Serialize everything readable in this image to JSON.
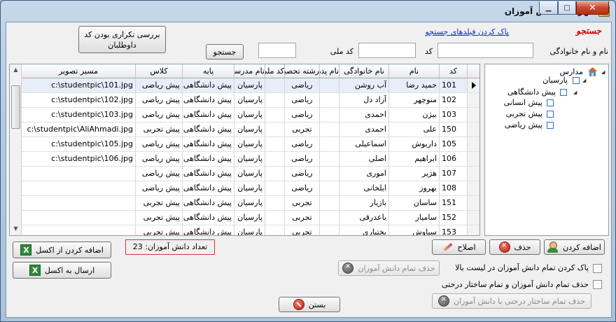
{
  "window": {
    "title": "فهرست دانش آموزان",
    "close_glyph": "✕",
    "minimize_glyph": "▁",
    "maximize_glyph": "□"
  },
  "search": {
    "title": "جستجو",
    "clear_link": "پاک کردن فیلدهای جستجو",
    "name_label": "نام و نام خانوادگی",
    "code_label": "کد",
    "national_code_label": "کد ملی",
    "search_button": "جستجو",
    "name_value": "",
    "code_value": "",
    "national_code_value": ""
  },
  "duplicate_button": {
    "line1": "بررسی تکراری بودن کد",
    "line2": "داوطلبان"
  },
  "grid": {
    "columns": [
      "کد",
      "نام",
      "نام خانوادگی",
      "نام پدر",
      "رشته تحصیلی",
      "کد ملی",
      "نام مدرسه",
      "پایه",
      "کلاس",
      "مسیر تصویر"
    ],
    "rows": [
      [
        "101",
        "حمید رضا",
        "آب روشن",
        "",
        "ریاضی",
        "",
        "پارسیان",
        "",
        "پیش دانشگاهی",
        "پیش ریاضی",
        "c:\\studentpic\\101.jpg"
      ],
      [
        "102",
        "منوچهر",
        "آزاد دل",
        "",
        "ریاضی",
        "",
        "پارسیان",
        "",
        "پیش دانشگاهی",
        "پیش ریاضی",
        "c:\\studentpic\\102.jpg"
      ],
      [
        "103",
        "بیژن",
        "احمدی",
        "",
        "ریاضی",
        "",
        "پارسیان",
        "",
        "پیش دانشگاهی",
        "پیش ریاضی",
        "c:\\studentpic\\103.jpg"
      ],
      [
        "150",
        "علی",
        "احمدی",
        "",
        "تجربی",
        "",
        "پارسیان",
        "",
        "پیش دانشگاهی",
        "پیش تجربی",
        "c:\\studentpic\\AliAhmadi.jpg"
      ],
      [
        "105",
        "داریوش",
        "اسماعیلی",
        "",
        "ریاضی",
        "",
        "پارسیان",
        "",
        "پیش دانشگاهی",
        "پیش ریاضی",
        "c:\\studentpic\\105.jpg"
      ],
      [
        "106",
        "ابراهیم",
        "اصلی",
        "",
        "ریاضی",
        "",
        "پارسیان",
        "",
        "پیش دانشگاهی",
        "پیش ریاضی",
        "c:\\studentpic\\106.jpg"
      ],
      [
        "107",
        "هژیر",
        "اموری",
        "",
        "ریاضی",
        "",
        "پارسیان",
        "",
        "پیش دانشگاهی",
        "پیش ریاضی",
        ""
      ],
      [
        "108",
        "بهروز",
        "ایلخانی",
        "",
        "ریاضی",
        "",
        "پارسیان",
        "",
        "پیش دانشگاهی",
        "پیش ریاضی",
        ""
      ],
      [
        "151",
        "ساسان",
        "بازیار",
        "",
        "تجربی",
        "",
        "پارسیان",
        "",
        "پیش دانشگاهی",
        "پیش تجربی",
        ""
      ],
      [
        "152",
        "سامیار",
        "باعدرقی",
        "",
        "تجربی",
        "",
        "پارسیان",
        "",
        "پیش دانشگاهی",
        "پیش تجربی",
        ""
      ],
      [
        "153",
        "سیاوش",
        "بختیاری",
        "",
        "تجربی",
        "",
        "پارسیان",
        "",
        "پیش دانشگاهی",
        "پیش تجربی",
        ""
      ]
    ]
  },
  "tree": {
    "root": "مدارس",
    "school": "پارسیان",
    "level": "پیش دانشگاهی",
    "classes": [
      "پیش انسانی",
      "پیش تجربی",
      "پیش ریاضی"
    ]
  },
  "actions": {
    "add": "اضافه کردن",
    "delete": "حذف",
    "edit": "اصلاح",
    "import_excel": "اضافه کردن از اکسل",
    "export_excel": "ارسال به  اکسل",
    "count_label": "تعداد دانش آموزان: 23",
    "clear_all_check": "پاک کردن تمام دانش آموزان در لیست بالا",
    "delete_all_students_button": "حذف تمام دانش آموزان",
    "delete_tree_check": "حذف تمام دانش آموزان و تمام ساختار درختی",
    "delete_tree_button": "حذف تمام ساختار درختی با دانش آموزان",
    "close": "بستن"
  }
}
